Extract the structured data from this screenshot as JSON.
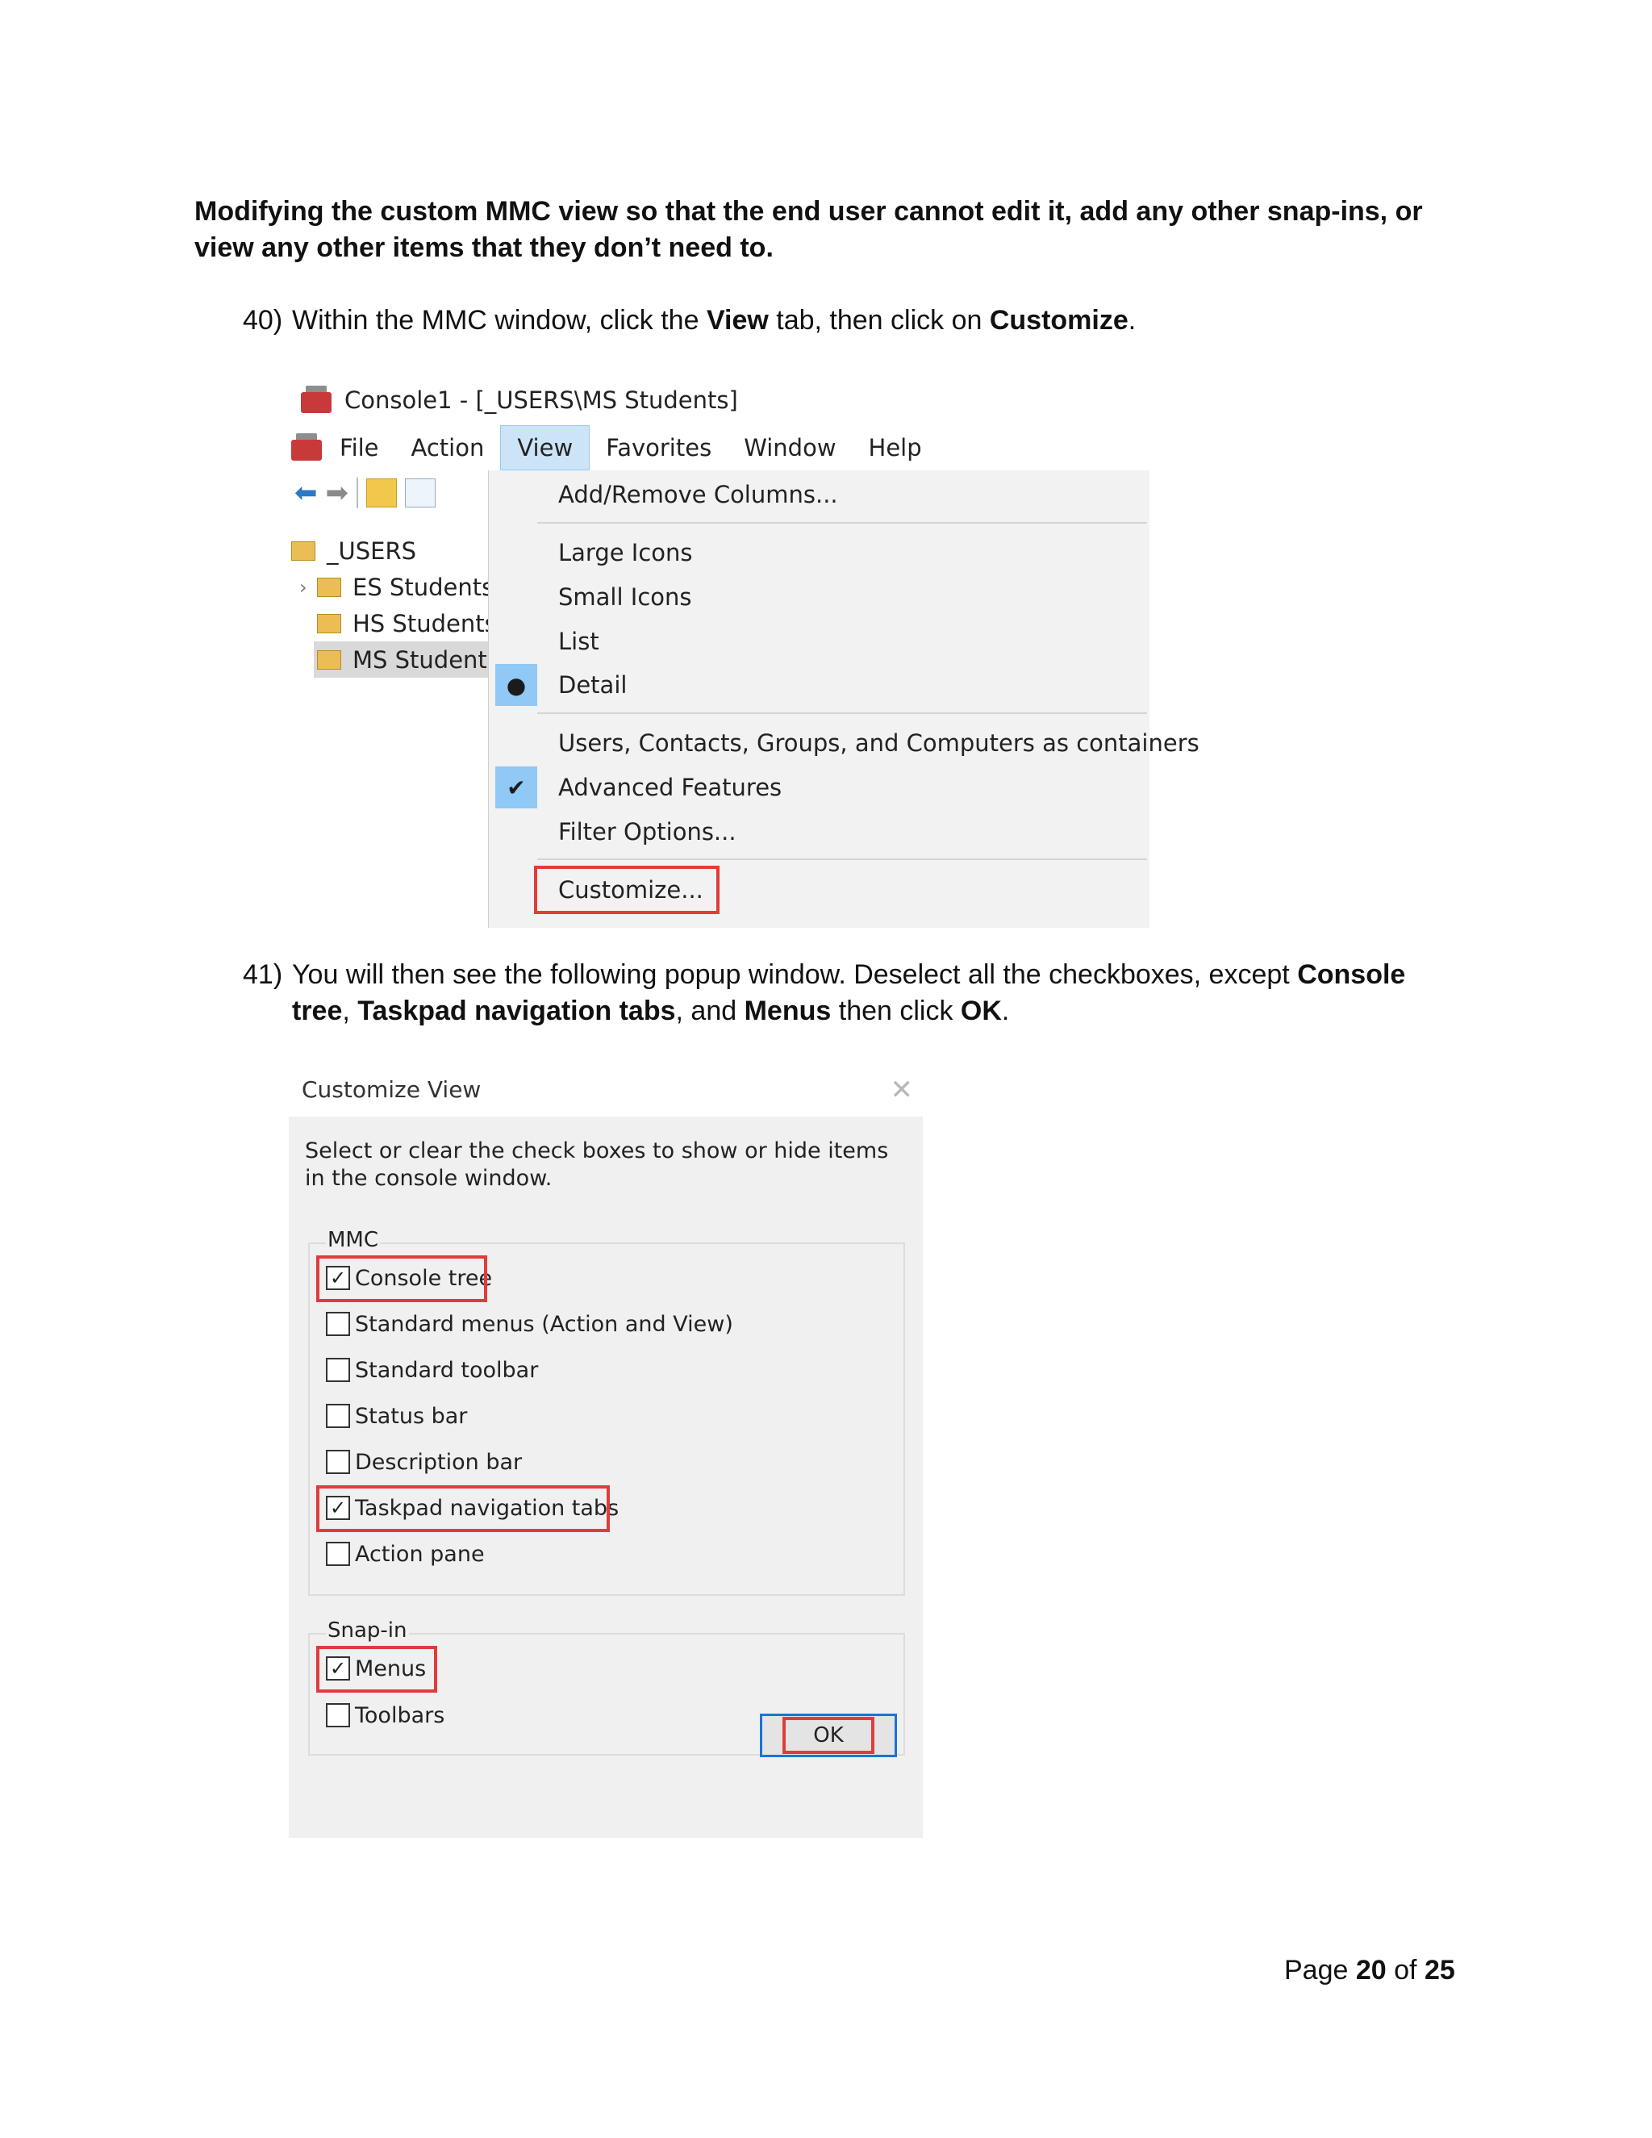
{
  "heading": "Modifying the custom MMC view so that the end user cannot edit it, add any other snap-ins, or view any other items that they don’t need to.",
  "step40": {
    "num": "40)",
    "t1": "Within the MMC window, click the ",
    "b1": "View",
    "t2": " tab, then click on ",
    "b2": "Customize",
    "t3": "."
  },
  "mmc": {
    "title": "Console1 - [_USERS\\MS Students]",
    "menu": [
      "File",
      "Action",
      "View",
      "Favorites",
      "Window",
      "Help"
    ],
    "tree": [
      "_USERS",
      "ES Students",
      "HS Students",
      "MS Students"
    ],
    "view_menu": {
      "add_remove_columns": "Add/Remove Columns...",
      "large_icons": "Large Icons",
      "small_icons": "Small Icons",
      "list": "List",
      "detail": "Detail",
      "users_contacts": "Users, Contacts, Groups, and Computers as containers",
      "advanced_features": "Advanced Features",
      "filter_options": "Filter Options...",
      "customize": "Customize...",
      "bullet": "●",
      "check": "✔"
    }
  },
  "step41": {
    "num": "41)",
    "t1": "You will then see the following popup window. Deselect all the checkboxes, except ",
    "b1": "Console tree",
    "t2": ", ",
    "b2": "Taskpad navigation tabs",
    "t3": ", and ",
    "b3": "Menus",
    "t4": " then click ",
    "b4": "OK",
    "t5": "."
  },
  "dialog": {
    "title": "Customize View",
    "close_glyph": "✕",
    "description": "Select or clear the check boxes to show or hide items in the console window.",
    "mmc_group": "MMC",
    "mmc_items": [
      {
        "label": "Console tree",
        "checked": true
      },
      {
        "label": "Standard menus (Action and View)",
        "checked": false
      },
      {
        "label": "Standard toolbar",
        "checked": false
      },
      {
        "label": "Status bar",
        "checked": false
      },
      {
        "label": "Description bar",
        "checked": false
      },
      {
        "label": "Taskpad navigation tabs",
        "checked": true
      },
      {
        "label": "Action pane",
        "checked": false
      }
    ],
    "snapin_group": "Snap-in",
    "snapin_items": [
      {
        "label": "Menus",
        "checked": true
      },
      {
        "label": "Toolbars",
        "checked": false
      }
    ],
    "ok_label": "OK",
    "check_glyph": "✓"
  },
  "footer": {
    "prefix": "Page ",
    "current": "20",
    "mid": " of ",
    "total": "25"
  },
  "colors": {
    "highlight_red": "#e23b3b",
    "menu_hover": "#cce4f7",
    "ok_border": "#1a73d9"
  }
}
